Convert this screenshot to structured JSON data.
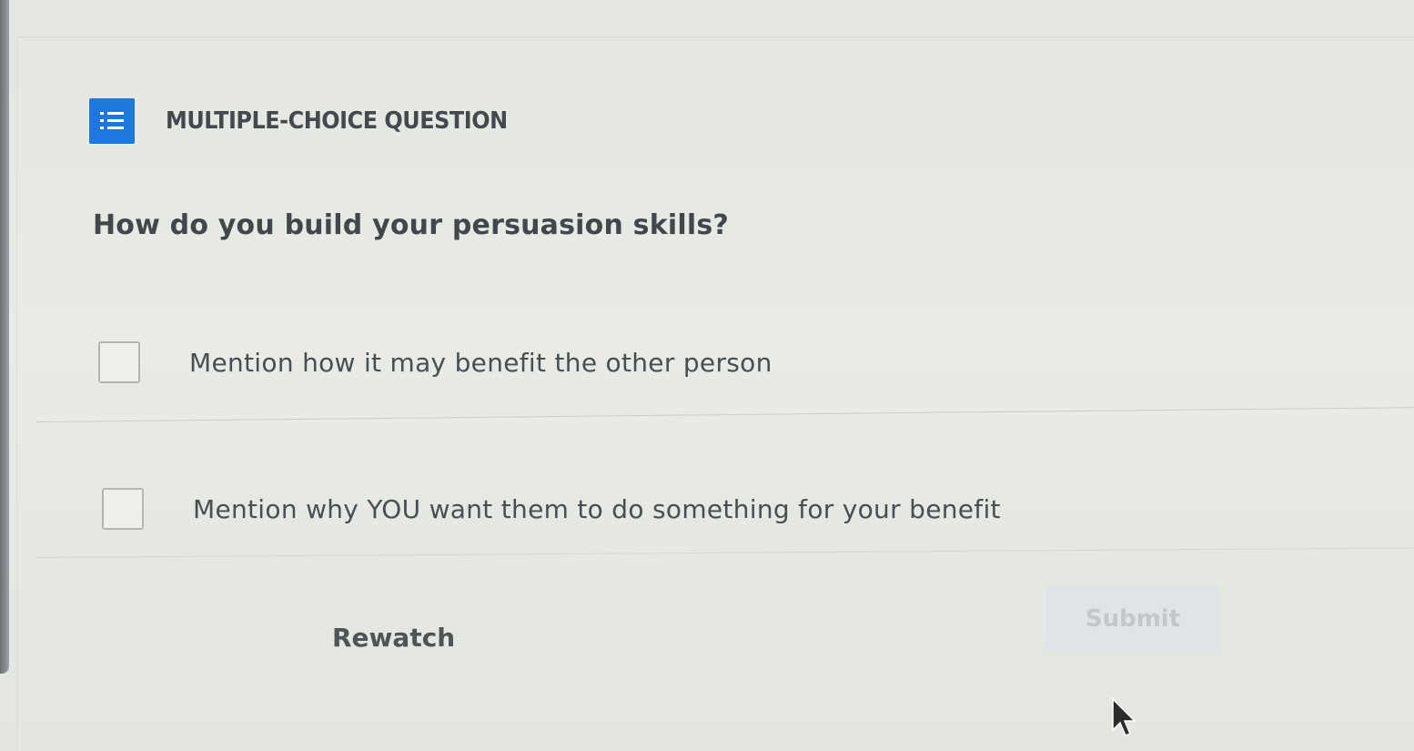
{
  "quiz": {
    "type_label": "MULTIPLE-CHOICE QUESTION",
    "type_icon": "checklist-icon",
    "question": "How do you build your persuasion skills?",
    "options": [
      {
        "label": "Mention how it may benefit the other person",
        "checked": false
      },
      {
        "label": "Mention why YOU want them to do something for your benefit",
        "checked": false
      }
    ]
  },
  "actions": {
    "rewatch_label": "Rewatch",
    "submit_label": "Submit",
    "submit_enabled": false
  },
  "colors": {
    "accent": "#1e78dc",
    "background": "#e6e8e3",
    "text": "#43474b",
    "submit_disabled_bg": "#e1e4e6",
    "submit_disabled_text": "#c3c7ca"
  }
}
